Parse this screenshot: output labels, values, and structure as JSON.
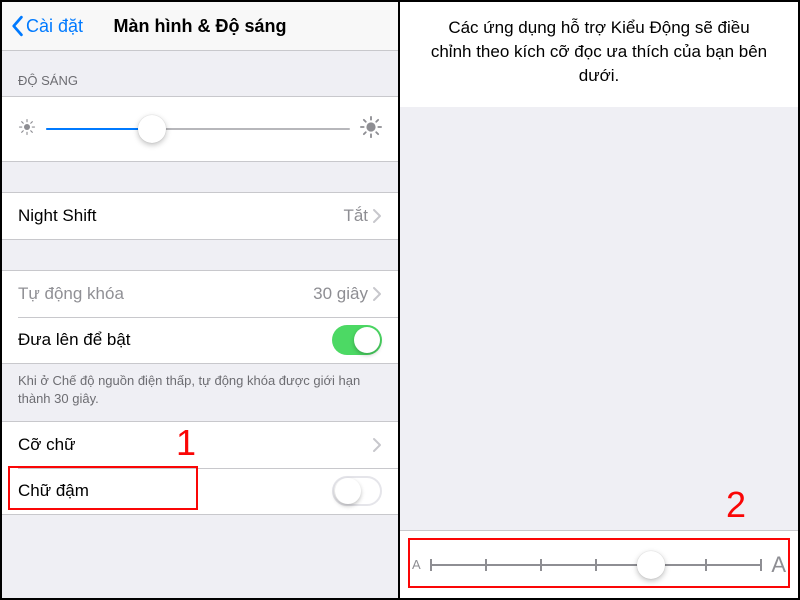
{
  "left": {
    "back_label": "Cài đặt",
    "title": "Màn hình & Độ sáng",
    "brightness_section_header": "ĐỘ SÁNG",
    "brightness_percent": 35,
    "night_shift_label": "Night Shift",
    "night_shift_value": "Tắt",
    "auto_lock_label": "Tự động khóa",
    "auto_lock_value": "30 giây",
    "raise_to_wake_label": "Đưa lên để bật",
    "raise_to_wake_on": true,
    "low_power_note": "Khi ở Chế độ nguồn điện thấp, tự động khóa được giới hạn thành 30 giây.",
    "text_size_label": "Cỡ chữ",
    "bold_text_label": "Chữ đậm",
    "bold_text_on": false,
    "annotation_number": "1"
  },
  "right": {
    "info_text": "Các ứng dụng hỗ trợ Kiểu Động sẽ điều chỉnh theo kích cỡ đọc ưa thích của bạn bên dưới.",
    "text_size_steps": 7,
    "text_size_index": 4,
    "small_A": "A",
    "big_A": "A",
    "annotation_number": "2"
  }
}
